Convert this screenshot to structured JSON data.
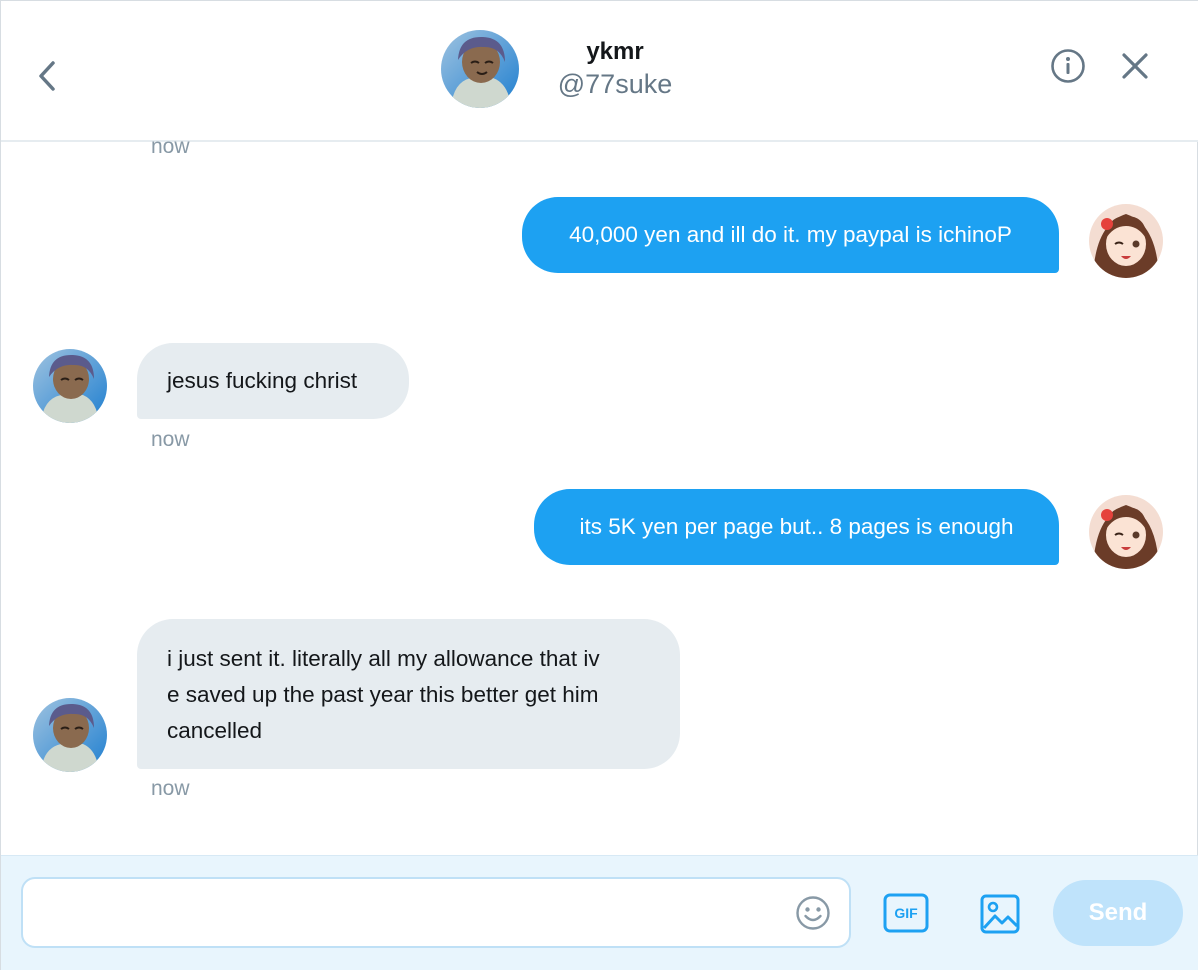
{
  "header": {
    "name": "ykmr",
    "handle": "@77suke",
    "back_icon": "chevron-left-icon",
    "info_icon": "info-icon",
    "close_icon": "close-icon"
  },
  "colors": {
    "sent_bubble": "#1da1f2",
    "received_bubble": "#e6ecf0",
    "timestamp": "#8899a6",
    "composer_bg": "#e8f5fd",
    "send_disabled": "#bfe3fb"
  },
  "messages": [
    {
      "type": "timestamp",
      "text": "now"
    },
    {
      "type": "sent",
      "text": "40,000 yen and ill do it. my paypal is ichinoP"
    },
    {
      "type": "received",
      "text": "jesus fucking christ",
      "time": "now"
    },
    {
      "type": "sent",
      "text": "its 5K yen per page but.. 8 pages is enough"
    },
    {
      "type": "received",
      "lines": [
        "i just sent it. literally all my allowance that iv",
        "e saved up the past year this better get him",
        "cancelled"
      ],
      "time": "now"
    }
  ],
  "composer": {
    "input_value": "",
    "emoji_icon": "smiley-icon",
    "gif_label": "GIF",
    "image_icon": "image-icon",
    "send_label": "Send"
  }
}
